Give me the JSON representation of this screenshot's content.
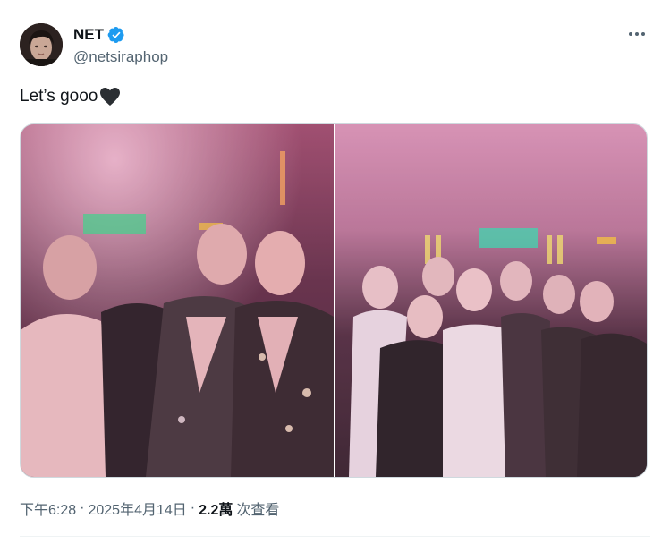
{
  "author": {
    "display_name": "NET",
    "handle": "@netsiraphop",
    "verified": true,
    "avatar": "profile-photo"
  },
  "tweet": {
    "text": "Let’s gooo",
    "emoji": "black-heart"
  },
  "media": [
    {
      "name": "group-photo-1",
      "description_icon": "photo"
    },
    {
      "name": "group-photo-2",
      "description_icon": "photo"
    }
  ],
  "meta": {
    "time": "下午6:28",
    "separator1": "·",
    "date": "2025年4月14日",
    "separator2": "·",
    "views_count": "2.2萬",
    "views_label": "次查看"
  },
  "icons": {
    "more": "more-dots-icon",
    "verified": "verified-badge-icon"
  },
  "colors": {
    "text_primary": "#0f1419",
    "text_secondary": "#536471",
    "verified_blue": "#1d9bf0",
    "photo_tint": "#c46a8e"
  }
}
